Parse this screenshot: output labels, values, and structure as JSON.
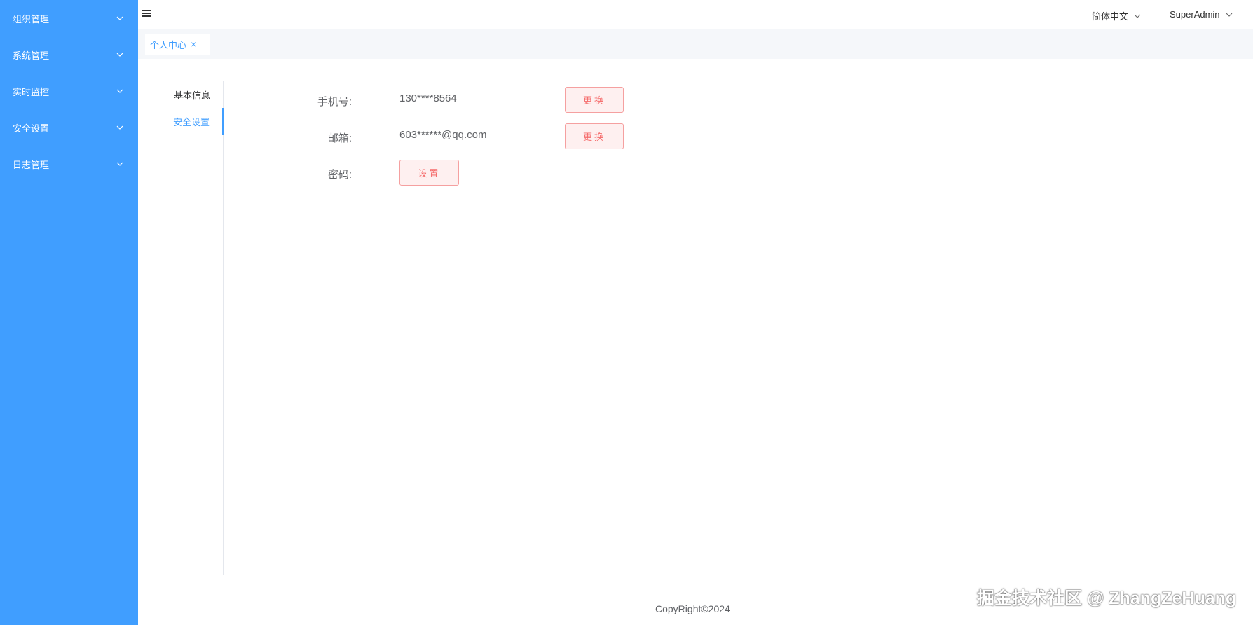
{
  "sidebar": {
    "items": [
      {
        "label": "组织管理"
      },
      {
        "label": "系统管理"
      },
      {
        "label": "实时监控"
      },
      {
        "label": "安全设置"
      },
      {
        "label": "日志管理"
      }
    ]
  },
  "header": {
    "language": "简体中文",
    "user": "SuperAdmin"
  },
  "tabs": [
    {
      "label": "个人中心",
      "close": "×"
    }
  ],
  "subnav": {
    "items": [
      {
        "label": "基本信息"
      },
      {
        "label": "安全设置"
      }
    ]
  },
  "security": {
    "phone": {
      "label": "手机号:",
      "value": "130****8564",
      "button": "更换"
    },
    "email": {
      "label": "邮箱:",
      "value": "603******@qq.com",
      "button": "更换"
    },
    "password": {
      "label": "密码:",
      "button": "设置"
    }
  },
  "footer": {
    "copyright": "CopyRight©2024"
  },
  "watermark": "掘金技术社区 @ ZhangZeHuang",
  "colors": {
    "primary": "#409eff",
    "danger": "#f56c6c"
  }
}
